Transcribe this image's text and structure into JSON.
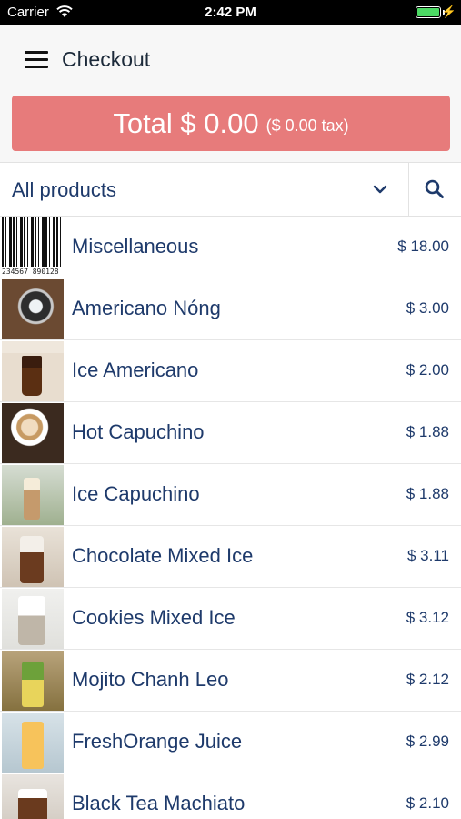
{
  "status_bar": {
    "carrier": "Carrier",
    "time": "2:42 PM",
    "battery_level": 1.0,
    "charging": true
  },
  "header": {
    "title": "Checkout",
    "menu_icon": "hamburger-menu-icon"
  },
  "total": {
    "label": "Total $ 0.00",
    "tax": "($ 0.00 tax)",
    "color": "#e77b7b"
  },
  "filter": {
    "category": "All products",
    "dropdown_icon": "chevron-down-icon",
    "search_icon": "search-icon"
  },
  "products": [
    {
      "name": "Miscellaneous",
      "price": "$ 18.00",
      "image": "barcode",
      "barcode_digits": "234567 890128"
    },
    {
      "name": "Americano Nóng",
      "price": "$ 3.00",
      "image": "hot-americano"
    },
    {
      "name": "Ice Americano",
      "price": "$ 2.00",
      "image": "iced-americano"
    },
    {
      "name": "Hot Capuchino",
      "price": "$ 1.88",
      "image": "hot-cappuccino"
    },
    {
      "name": "Ice Capuchino",
      "price": "$ 1.88",
      "image": "iced-cappuccino"
    },
    {
      "name": "Chocolate Mixed Ice",
      "price": "$ 3.11",
      "image": "chocolate-frappe"
    },
    {
      "name": "Cookies Mixed Ice",
      "price": "$ 3.12",
      "image": "cookies-frappe"
    },
    {
      "name": "Mojito Chanh Leo",
      "price": "$ 2.12",
      "image": "mojito"
    },
    {
      "name": "FreshOrange Juice",
      "price": "$ 2.99",
      "image": "orange-juice"
    },
    {
      "name": "Black Tea Machiato",
      "price": "$ 2.10",
      "image": "black-tea"
    }
  ],
  "colors": {
    "text_primary": "#1e3a6b",
    "header_bg": "#f7f7f7"
  }
}
